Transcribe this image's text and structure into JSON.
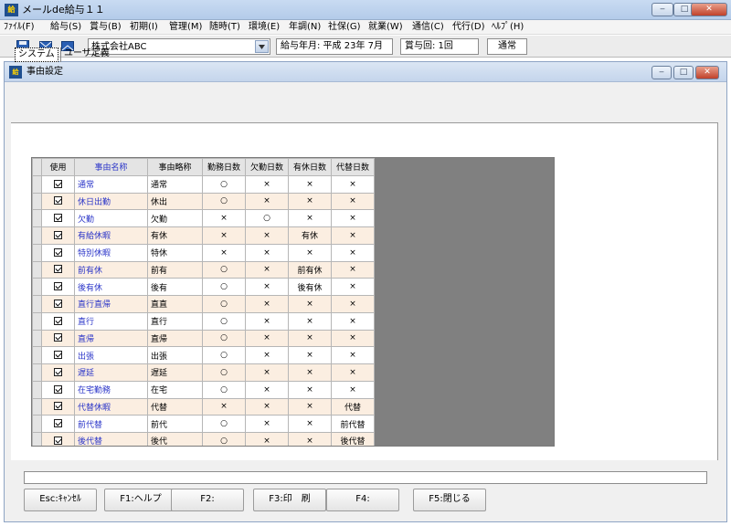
{
  "app": {
    "title": "メールde給与１１",
    "icon_text": "給"
  },
  "window_controls": {
    "minimize": "‒",
    "maximize": "□",
    "close": "✕"
  },
  "menu": [
    "ﾌｧｲﾙ(F)",
    "給与(S)",
    "賞与(B)",
    "初期(I)",
    "管理(M)",
    "随時(T)",
    "環境(E)",
    "年調(N)",
    "社保(G)",
    "就業(W)",
    "通信(C)",
    "代行(D)",
    "ﾍﾙﾌﾟ(H)"
  ],
  "toolbar": {
    "company": "株式会社ABC",
    "pay_month": "給与年月: 平成 23年  7月",
    "bonus": "賞与回: 1回",
    "mode": "通常"
  },
  "child": {
    "title": "事由設定",
    "icon_text": "給"
  },
  "tabs": [
    "システム",
    "ユーザ定義"
  ],
  "table": {
    "headers": [
      "使用",
      "事由名称",
      "事由略称",
      "勤務日数",
      "欠勤日数",
      "有休日数",
      "代替日数"
    ],
    "rows": [
      {
        "use": true,
        "name": "通常",
        "short": "通常",
        "work": "○",
        "absent": "×",
        "paid": "×",
        "sub": "×"
      },
      {
        "use": true,
        "name": "休日出勤",
        "short": "休出",
        "work": "○",
        "absent": "×",
        "paid": "×",
        "sub": "×"
      },
      {
        "use": true,
        "name": "欠勤",
        "short": "欠勤",
        "work": "×",
        "absent": "○",
        "paid": "×",
        "sub": "×"
      },
      {
        "use": true,
        "name": "有給休暇",
        "short": "有休",
        "work": "×",
        "absent": "×",
        "paid": "有休",
        "sub": "×"
      },
      {
        "use": true,
        "name": "特別休暇",
        "short": "特休",
        "work": "×",
        "absent": "×",
        "paid": "×",
        "sub": "×"
      },
      {
        "use": true,
        "name": "前有休",
        "short": "前有",
        "work": "○",
        "absent": "×",
        "paid": "前有休",
        "sub": "×"
      },
      {
        "use": true,
        "name": "後有休",
        "short": "後有",
        "work": "○",
        "absent": "×",
        "paid": "後有休",
        "sub": "×"
      },
      {
        "use": true,
        "name": "直行直帰",
        "short": "直直",
        "work": "○",
        "absent": "×",
        "paid": "×",
        "sub": "×"
      },
      {
        "use": true,
        "name": "直行",
        "short": "直行",
        "work": "○",
        "absent": "×",
        "paid": "×",
        "sub": "×"
      },
      {
        "use": true,
        "name": "直帰",
        "short": "直帰",
        "work": "○",
        "absent": "×",
        "paid": "×",
        "sub": "×"
      },
      {
        "use": true,
        "name": "出張",
        "short": "出張",
        "work": "○",
        "absent": "×",
        "paid": "×",
        "sub": "×"
      },
      {
        "use": true,
        "name": "遅延",
        "short": "遅延",
        "work": "○",
        "absent": "×",
        "paid": "×",
        "sub": "×"
      },
      {
        "use": true,
        "name": "在宅勤務",
        "short": "在宅",
        "work": "○",
        "absent": "×",
        "paid": "×",
        "sub": "×"
      },
      {
        "use": true,
        "name": "代替休暇",
        "short": "代替",
        "work": "×",
        "absent": "×",
        "paid": "×",
        "sub": "代替"
      },
      {
        "use": true,
        "name": "前代替",
        "short": "前代",
        "work": "○",
        "absent": "×",
        "paid": "×",
        "sub": "前代替"
      },
      {
        "use": true,
        "name": "後代替",
        "short": "後代",
        "work": "○",
        "absent": "×",
        "paid": "×",
        "sub": "後代替"
      }
    ]
  },
  "fkeys": [
    "Esc:ｷｬﾝｾﾙ",
    "F1:ヘルプ",
    "F2:",
    "F3:印　刷",
    "F4:",
    "F5:閉じる"
  ]
}
